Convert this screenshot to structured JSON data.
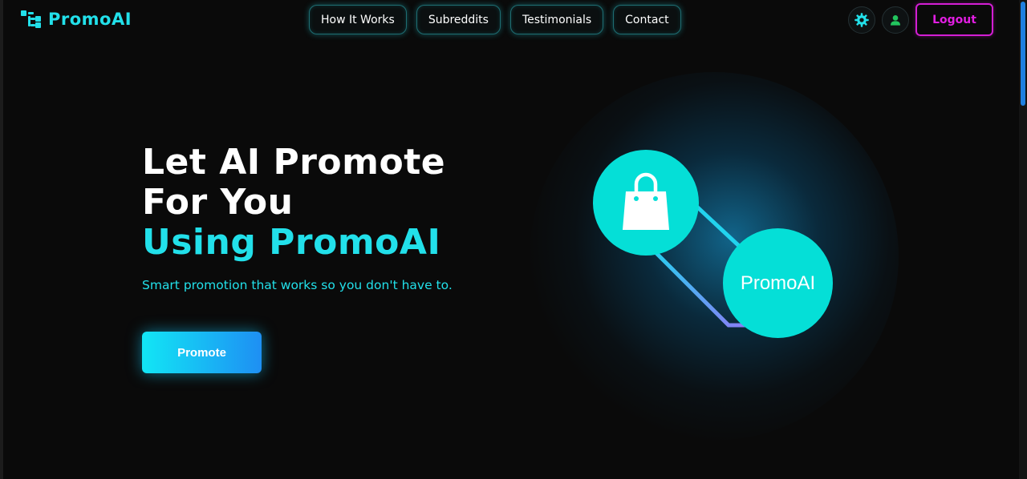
{
  "brand": {
    "name": "PromoAI",
    "logo_icon": "network-logo-icon",
    "accent": "#22e0ea"
  },
  "nav": {
    "links": [
      "How It Works",
      "Subreddits",
      "Testimonials",
      "Contact"
    ],
    "settings_icon": "gear-icon",
    "profile_icon": "user-icon",
    "logout_label": "Logout"
  },
  "hero": {
    "title_line1": "Let AI Promote",
    "title_line2": "For You",
    "title_accent": "Using PromoAI",
    "subtitle": "Smart promotion that works so you don't have to.",
    "cta_label": "Promote"
  },
  "illustration": {
    "bag_icon": "shopping-bag-icon",
    "node_label": "PromoAI"
  },
  "colors": {
    "background": "#0a0a0a",
    "cyan": "#22e0ea",
    "node": "#05dfd7",
    "logout_magenta": "#e21ee2",
    "profile_green": "#22c55e"
  }
}
